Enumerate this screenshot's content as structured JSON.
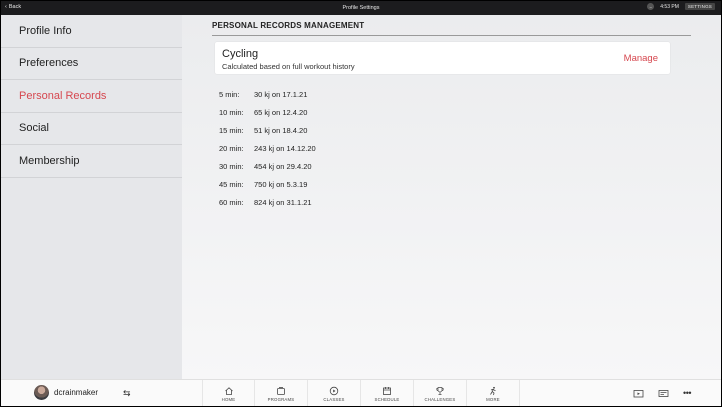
{
  "topbar": {
    "back_label": "Back",
    "title": "Profile Settings",
    "time": "4:53 PM",
    "settings_label": "SETTINGS"
  },
  "sidebar": {
    "items": [
      {
        "label": "Profile Info",
        "active": false
      },
      {
        "label": "Preferences",
        "active": false
      },
      {
        "label": "Personal Records",
        "active": true
      },
      {
        "label": "Social",
        "active": false
      },
      {
        "label": "Membership",
        "active": false
      }
    ]
  },
  "main": {
    "section_title": "PERSONAL RECORDS MANAGEMENT",
    "card": {
      "sport": "Cycling",
      "subtitle": "Calculated based on full workout history",
      "manage_label": "Manage"
    },
    "records": [
      {
        "duration": "5 min:",
        "value": "30 kj on 17.1.21"
      },
      {
        "duration": "10 min:",
        "value": "65 kj on 12.4.20"
      },
      {
        "duration": "15 min:",
        "value": "51 kj on 18.4.20"
      },
      {
        "duration": "20 min:",
        "value": "243 kj on 14.12.20"
      },
      {
        "duration": "30 min:",
        "value": "454 kj on 29.4.20"
      },
      {
        "duration": "45 min:",
        "value": "750 kj on 5.3.19"
      },
      {
        "duration": "60 min:",
        "value": "824 kj on 31.1.21"
      }
    ]
  },
  "bottombar": {
    "username": "dcrainmaker",
    "nav": [
      {
        "label": "HOME",
        "icon": "home-icon"
      },
      {
        "label": "PROGRAMS",
        "icon": "programs-icon"
      },
      {
        "label": "CLASSES",
        "icon": "play-icon"
      },
      {
        "label": "SCHEDULE",
        "icon": "calendar-icon"
      },
      {
        "label": "CHALLENGES",
        "icon": "trophy-icon"
      },
      {
        "label": "MORE",
        "icon": "runner-icon"
      }
    ],
    "more_glyph": "•••"
  },
  "colors": {
    "accent": "#d6474f",
    "topbar": "#1c1c1e",
    "sidebar": "#e6e7ea"
  }
}
